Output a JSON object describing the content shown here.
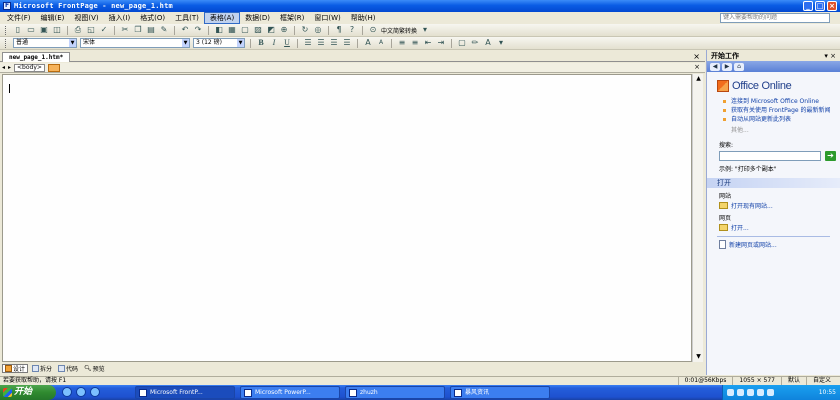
{
  "window": {
    "title": "Microsoft FrontPage - new_page_1.htm",
    "controls": [
      "_",
      "□",
      "×"
    ]
  },
  "menu": {
    "items": [
      "文件(F)",
      "编辑(E)",
      "视图(V)",
      "插入(I)",
      "格式(O)",
      "工具(T)",
      "表格(A)",
      "数据(D)",
      "框架(R)",
      "窗口(W)",
      "帮助(H)"
    ],
    "active_index": 6,
    "help_placeholder": "键入需要帮助的问题"
  },
  "toolbar1": {
    "language_label": "中文简繁转换"
  },
  "toolbar2": {
    "style_value": "普通",
    "font_value": "宋体",
    "size_value": "3 (12 磅)",
    "bold": "B",
    "italic": "I",
    "underline": "U",
    "grow_font": "A",
    "shrink_font": "A"
  },
  "document": {
    "tab_label": "new_page_1.htm*",
    "tag_label": "<body>",
    "view_tabs": [
      "设计",
      "拆分",
      "代码",
      "预览"
    ]
  },
  "task_pane": {
    "title": "开始工作",
    "logo_text": "Office Online",
    "links": [
      "连接到 Microsoft Office Online",
      "获取有关使用 FrontPage 的最新新闻",
      "自动从网站更新此列表"
    ],
    "more": "其他...",
    "search_label": "搜索:",
    "example": "示例: \"打印多个副本\"",
    "open_title": "打开",
    "site_label": "网站",
    "site_link": "打开现有网站...",
    "page_label": "网页",
    "page_link": "打开...",
    "new_link": "新建网页或网站..."
  },
  "status": {
    "left": "若要获取帮助，请按 F1",
    "speed": "0:01@56Kbps",
    "size": "1055 × 577",
    "mode": "默认",
    "custom": "自定义"
  },
  "taskbar": {
    "start": "开始",
    "tasks": [
      "Microsoft FrontP...",
      "Microsoft PowerP...",
      "zhuzh",
      "暴风资讯"
    ],
    "active_task": 0,
    "clock": "10:55"
  }
}
